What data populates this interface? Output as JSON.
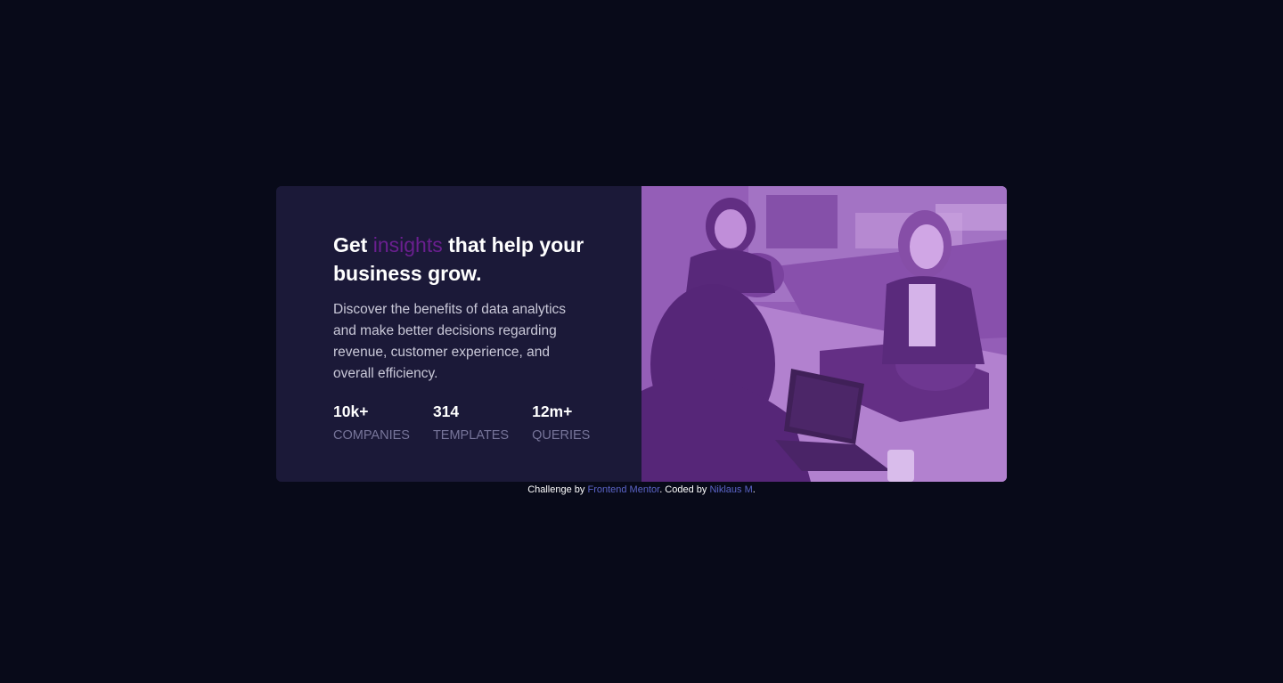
{
  "card": {
    "headline": {
      "before": "Get ",
      "accent": "insights",
      "after": " that help your business grow."
    },
    "description": "Discover the benefits of data analytics and make better decisions regarding revenue, customer experience, and overall efficiency.",
    "stats": [
      {
        "value": "10k+",
        "label": "COMPANIES"
      },
      {
        "value": "314",
        "label": "TEMPLATES"
      },
      {
        "value": "12m+",
        "label": "QUERIES"
      }
    ]
  },
  "attribution": {
    "prefix": "Challenge by ",
    "challenge_link": "Frontend Mentor",
    "middle": ". Coded by ",
    "author_link": "Niklaus M",
    "suffix": "."
  },
  "colors": {
    "page_background": "#080a19",
    "card_background": "#1b1938",
    "accent": "#6a1f8f",
    "image_overlay": "#8a5aa8",
    "link": "#5b64c7"
  }
}
